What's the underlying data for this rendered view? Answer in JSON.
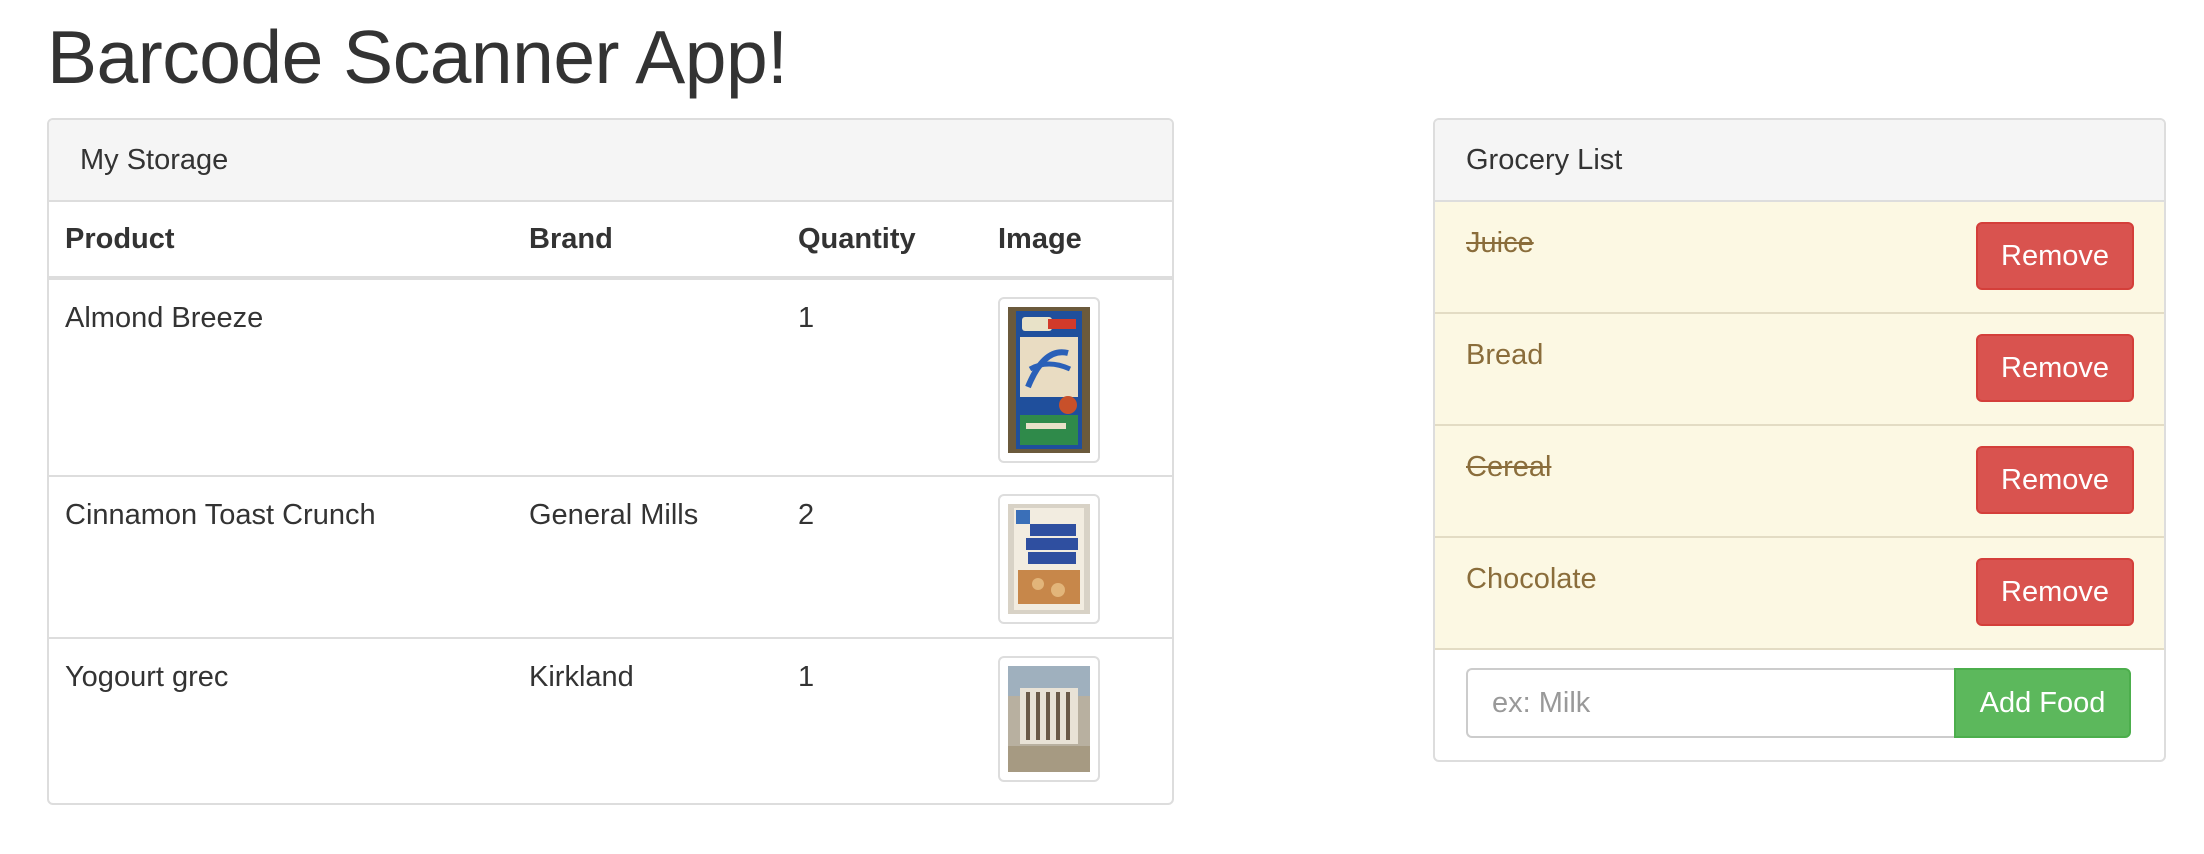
{
  "app": {
    "title": "Barcode Scanner App!"
  },
  "storage": {
    "heading": "My Storage",
    "columns": [
      "Product",
      "Brand",
      "Quantity",
      "Image"
    ],
    "rows": [
      {
        "product": "Almond Breeze",
        "brand": "",
        "quantity": "1",
        "image": "almond-breeze-carton-image"
      },
      {
        "product": "Cinnamon Toast Crunch",
        "brand": "General Mills",
        "quantity": "2",
        "image": "cereal-box-image"
      },
      {
        "product": "Yogourt grec",
        "brand": "Kirkland",
        "quantity": "1",
        "image": "yogurt-container-image"
      }
    ]
  },
  "grocery": {
    "heading": "Grocery List",
    "items": [
      {
        "name": "Juice",
        "done": true,
        "remove_label": "Remove"
      },
      {
        "name": "Bread",
        "done": false,
        "remove_label": "Remove"
      },
      {
        "name": "Cereal",
        "done": true,
        "remove_label": "Remove"
      },
      {
        "name": "Chocolate",
        "done": false,
        "remove_label": "Remove"
      }
    ],
    "input_placeholder": "ex: Milk",
    "input_value": "",
    "add_label": "Add Food"
  },
  "colors": {
    "danger": "#d9534f",
    "success": "#5cb85c",
    "warning_bg": "#fcf8e3",
    "warning_text": "#8a6d3b",
    "panel_heading_bg": "#f5f5f5"
  }
}
